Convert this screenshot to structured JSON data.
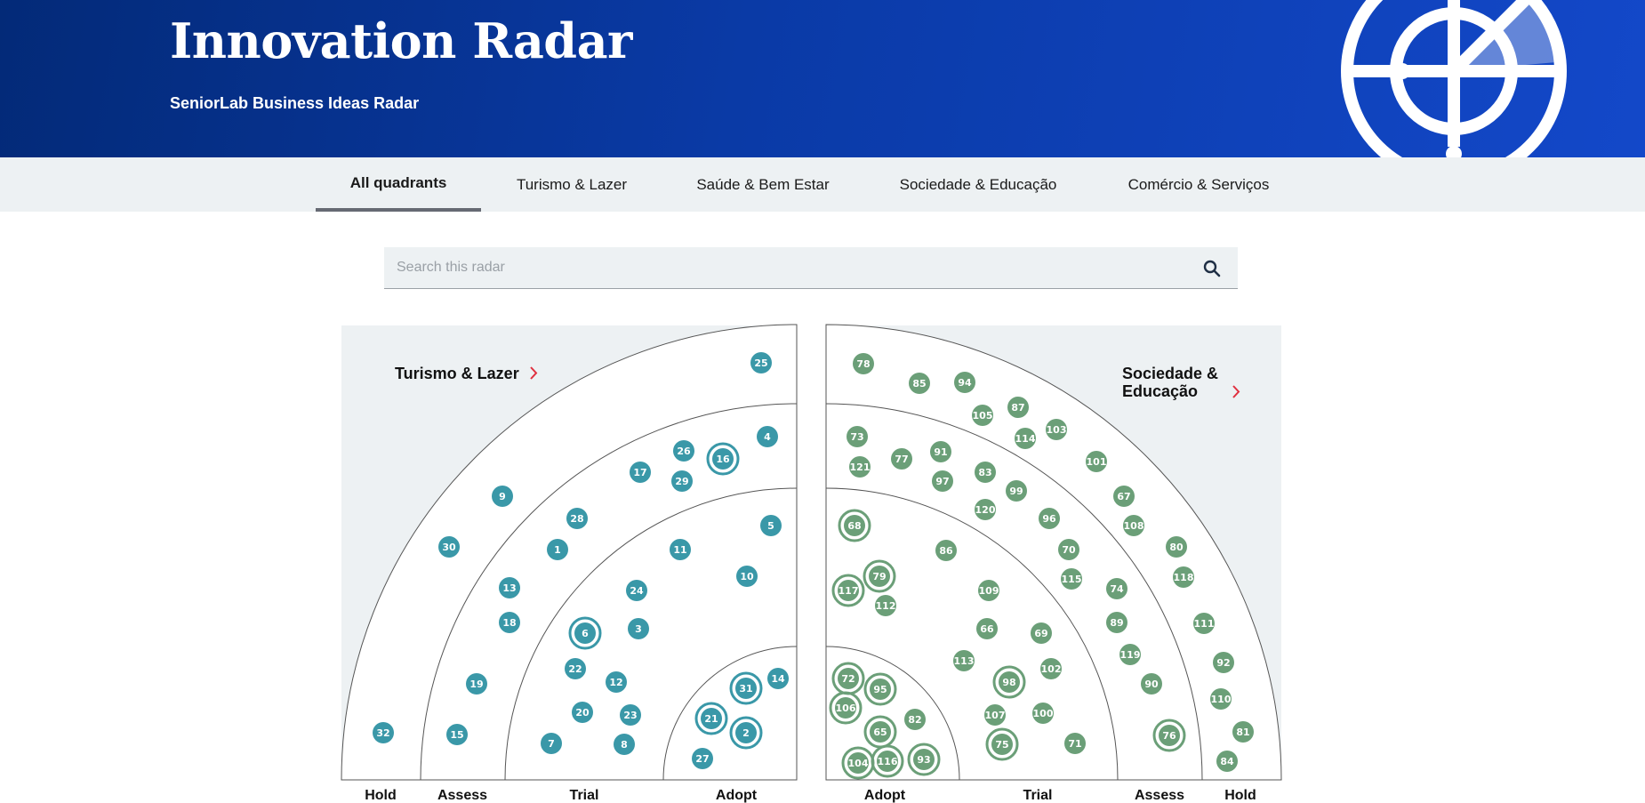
{
  "header": {
    "title": "Innovation Radar",
    "subtitle": "SeniorLab Business Ideas Radar",
    "logo_icon": "radar-logo-icon"
  },
  "nav": {
    "tabs": [
      {
        "label": "All quadrants",
        "active": true
      },
      {
        "label": "Turismo & Lazer",
        "active": false
      },
      {
        "label": "Saúde & Bem Estar",
        "active": false
      },
      {
        "label": "Sociedade & Educação",
        "active": false
      },
      {
        "label": "Comércio & Serviços",
        "active": false
      }
    ]
  },
  "search": {
    "placeholder": "Search this radar",
    "value": "",
    "icon": "search-icon"
  },
  "colors": {
    "turismo": "#3a98a8",
    "sociedade": "#6b9f78",
    "quadrant_bg": "#edf1f3",
    "chevron": "#e0303f"
  },
  "quadrants": {
    "left": {
      "title": "Turismo & Lazer",
      "rings": [
        "Hold",
        "Assess",
        "Trial",
        "Adopt"
      ]
    },
    "right": {
      "title_line1": "Sociedade &",
      "title_line2": "Educação",
      "rings": [
        "Adopt",
        "Trial",
        "Assess",
        "Hold"
      ]
    }
  },
  "blips_left": [
    {
      "n": "25"
    },
    {
      "n": "4"
    },
    {
      "n": "26"
    },
    {
      "n": "16",
      "new": true
    },
    {
      "n": "29"
    },
    {
      "n": "17"
    },
    {
      "n": "9"
    },
    {
      "n": "28"
    },
    {
      "n": "30"
    },
    {
      "n": "1"
    },
    {
      "n": "11"
    },
    {
      "n": "5"
    },
    {
      "n": "10"
    },
    {
      "n": "13"
    },
    {
      "n": "24"
    },
    {
      "n": "18"
    },
    {
      "n": "6",
      "new": true
    },
    {
      "n": "3"
    },
    {
      "n": "22"
    },
    {
      "n": "12"
    },
    {
      "n": "19"
    },
    {
      "n": "31",
      "new": true
    },
    {
      "n": "14"
    },
    {
      "n": "20"
    },
    {
      "n": "23"
    },
    {
      "n": "21",
      "new": true
    },
    {
      "n": "2",
      "new": true
    },
    {
      "n": "32"
    },
    {
      "n": "15"
    },
    {
      "n": "7"
    },
    {
      "n": "8"
    },
    {
      "n": "27"
    }
  ],
  "blips_right": [
    {
      "n": "78"
    },
    {
      "n": "85"
    },
    {
      "n": "94"
    },
    {
      "n": "87"
    },
    {
      "n": "105"
    },
    {
      "n": "114"
    },
    {
      "n": "103"
    },
    {
      "n": "73"
    },
    {
      "n": "91"
    },
    {
      "n": "77"
    },
    {
      "n": "121"
    },
    {
      "n": "83"
    },
    {
      "n": "97"
    },
    {
      "n": "101"
    },
    {
      "n": "99"
    },
    {
      "n": "67"
    },
    {
      "n": "120"
    },
    {
      "n": "96"
    },
    {
      "n": "68",
      "new": true
    },
    {
      "n": "108"
    },
    {
      "n": "86"
    },
    {
      "n": "70"
    },
    {
      "n": "80"
    },
    {
      "n": "79",
      "new": true
    },
    {
      "n": "117",
      "new": true
    },
    {
      "n": "115"
    },
    {
      "n": "118"
    },
    {
      "n": "112"
    },
    {
      "n": "109"
    },
    {
      "n": "74"
    },
    {
      "n": "66"
    },
    {
      "n": "69"
    },
    {
      "n": "89"
    },
    {
      "n": "111"
    },
    {
      "n": "113"
    },
    {
      "n": "119"
    },
    {
      "n": "102"
    },
    {
      "n": "92"
    },
    {
      "n": "72",
      "new": true
    },
    {
      "n": "95",
      "new": true
    },
    {
      "n": "98",
      "new": true
    },
    {
      "n": "90"
    },
    {
      "n": "106",
      "new": true
    },
    {
      "n": "110"
    },
    {
      "n": "107"
    },
    {
      "n": "100"
    },
    {
      "n": "82"
    },
    {
      "n": "65",
      "new": true
    },
    {
      "n": "76",
      "new": true
    },
    {
      "n": "81"
    },
    {
      "n": "75",
      "new": true
    },
    {
      "n": "71"
    },
    {
      "n": "104",
      "new": true
    },
    {
      "n": "116",
      "new": true
    },
    {
      "n": "93",
      "new": true
    },
    {
      "n": "84"
    }
  ]
}
